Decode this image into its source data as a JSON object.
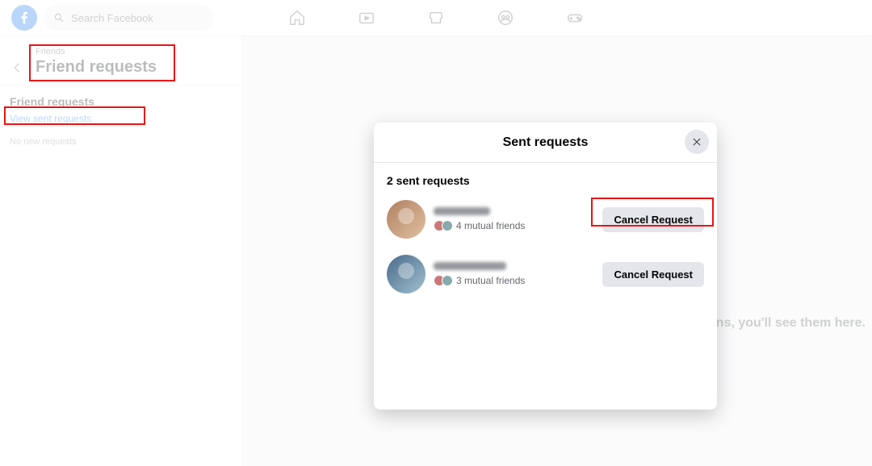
{
  "search": {
    "placeholder": "Search Facebook"
  },
  "sidebar": {
    "crumb": "Friends",
    "title": "Friend requests",
    "section": "Friend requests",
    "view_link": "View sent requests",
    "empty": "No new requests"
  },
  "bg_hint_fragment": "ns, you'll see them here.",
  "modal": {
    "title": "Sent requests",
    "count_label": "2 sent requests",
    "cancel_label": "Cancel Request",
    "items": [
      {
        "mutual": "4 mutual friends"
      },
      {
        "mutual": "3 mutual friends"
      }
    ]
  }
}
